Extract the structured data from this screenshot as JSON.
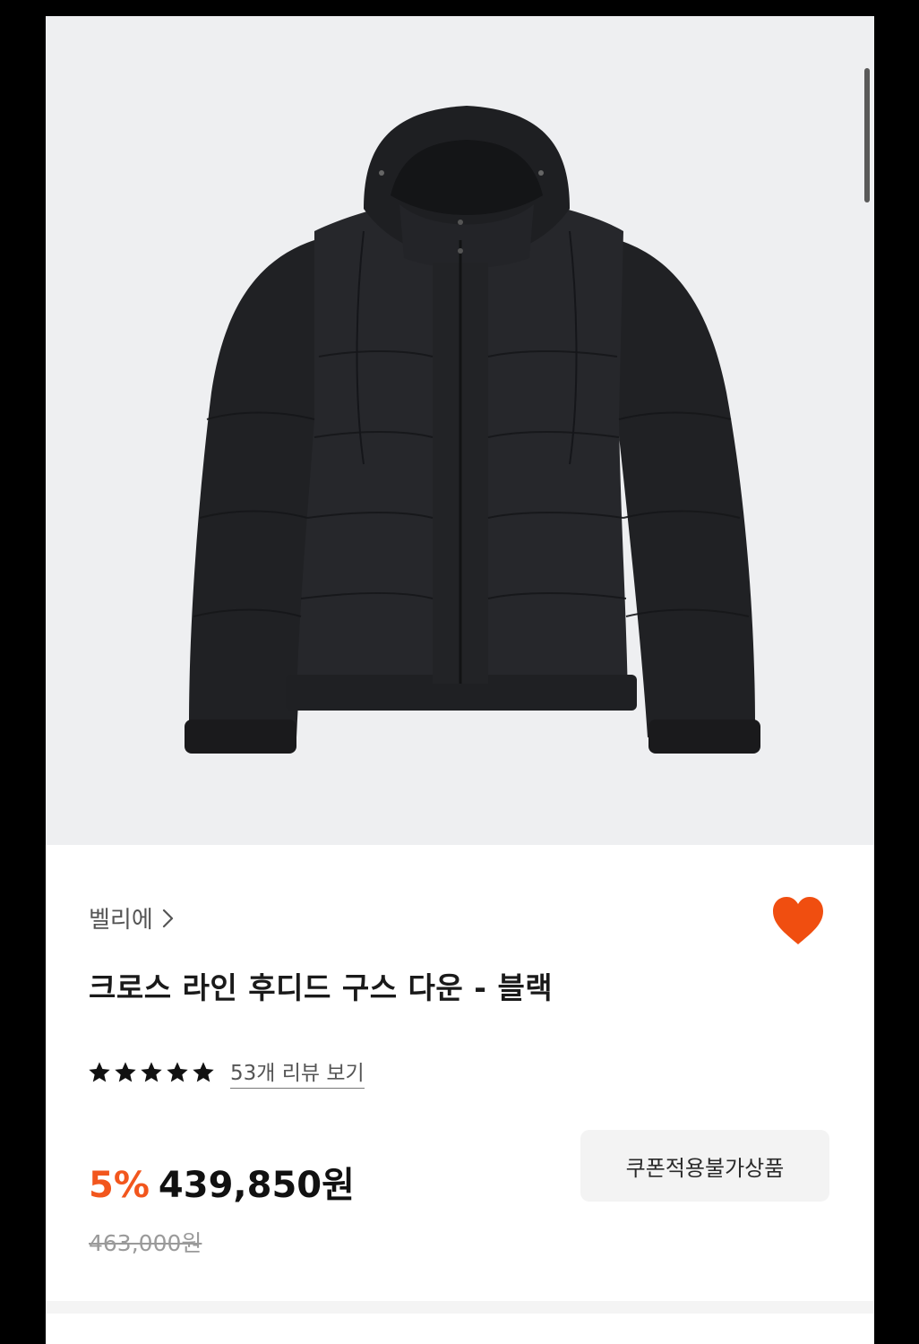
{
  "product": {
    "image_alt": "black hooded down jacket",
    "brand": "벨리에",
    "title": "크로스 라인 후디드 구스 다운 - 블랙",
    "rating_stars": 5,
    "review_link": "53개 리뷰 보기",
    "discount": "5%",
    "price": "439,850원",
    "original_price": "463,000원",
    "coupon_notice": "쿠폰적용불가상품",
    "liked": true
  },
  "colors": {
    "accent": "#f2561d",
    "heart": "#f04e10",
    "hero_bg": "#eeeff1",
    "jacket": "#232427"
  },
  "icons": {
    "brand_chevron": "chevron-right-icon",
    "wishlist": "heart-icon",
    "rating": "star-icon"
  }
}
